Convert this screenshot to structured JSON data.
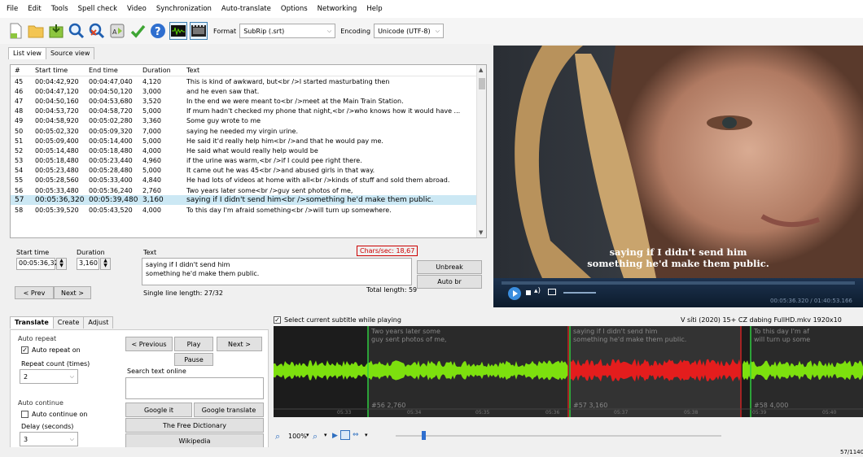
{
  "menu": [
    "File",
    "Edit",
    "Tools",
    "Spell check",
    "Video",
    "Synchronization",
    "Auto-translate",
    "Options",
    "Networking",
    "Help"
  ],
  "toolbar": {
    "format_label": "Format",
    "format_value": "SubRip (.srt)",
    "encoding_label": "Encoding",
    "encoding_value": "Unicode (UTF-8)"
  },
  "tabs": {
    "list_view": "List view",
    "source_view": "Source view"
  },
  "list": {
    "headers": [
      "#",
      "Start time",
      "End time",
      "Duration",
      "Text"
    ],
    "rows": [
      [
        "45",
        "00:04:42,920",
        "00:04:47,040",
        "4,120",
        "This is kind of awkward, but<br />I started masturbating then"
      ],
      [
        "46",
        "00:04:47,120",
        "00:04:50,120",
        "3,000",
        "and he even saw that."
      ],
      [
        "47",
        "00:04:50,160",
        "00:04:53,680",
        "3,520",
        "In the end we were meant to<br />meet at the Main Train Station."
      ],
      [
        "48",
        "00:04:53,720",
        "00:04:58,720",
        "5,000",
        "If mum hadn't checked my phone that night,<br />who knows how it would have ..."
      ],
      [
        "49",
        "00:04:58,920",
        "00:05:02,280",
        "3,360",
        "Some guy wrote to me"
      ],
      [
        "50",
        "00:05:02,320",
        "00:05:09,320",
        "7,000",
        "saying he needed my virgin urine."
      ],
      [
        "51",
        "00:05:09,400",
        "00:05:14,400",
        "5,000",
        "He said it'd really help him<br />and that he would pay me."
      ],
      [
        "52",
        "00:05:14,480",
        "00:05:18,480",
        "4,000",
        "He said what would really help would be"
      ],
      [
        "53",
        "00:05:18,480",
        "00:05:23,440",
        "4,960",
        "if the urine was warm,<br />if I could pee right there."
      ],
      [
        "54",
        "00:05:23,480",
        "00:05:28,480",
        "5,000",
        "It came out he was 45<br />and abused girls in that way."
      ],
      [
        "55",
        "00:05:28,560",
        "00:05:33,400",
        "4,840",
        "He had lots of videos at home with all<br />kinds of stuff and sold them abroad."
      ],
      [
        "56",
        "00:05:33,480",
        "00:05:36,240",
        "2,760",
        "Two years later some<br />guy sent photos of me,"
      ],
      [
        "57",
        "00:05:36,320",
        "00:05:39,480",
        "3,160",
        "saying if I didn't send him<br />something he'd make them public."
      ],
      [
        "58",
        "00:05:39,520",
        "00:05:43,520",
        "4,000",
        "To this day I'm afraid something<br />will turn up somewhere."
      ]
    ],
    "selected_index": 12
  },
  "edit": {
    "start_label": "Start time",
    "start_value": "00:05:36,320",
    "duration_label": "Duration",
    "duration_value": "3,160",
    "text_label": "Text",
    "text_line1": "saying if I didn't send him",
    "text_line2": "something he'd make them public.",
    "chars_sec": "Chars/sec: 18,67",
    "single_line": "Single line length: 27/32",
    "total_length": "Total length: 59",
    "unbreak": "Unbreak",
    "auto_br": "Auto br",
    "prev": "< Prev",
    "next": "Next >"
  },
  "video": {
    "sub_line1": "saying if I didn't send him",
    "sub_line2": "something he'd make them public.",
    "time": "00:05:36.320 / 01:40:53.166"
  },
  "bottom_tabs": [
    "Translate",
    "Create",
    "Adjust"
  ],
  "translate": {
    "auto_repeat_title": "Auto repeat",
    "auto_repeat_on": "Auto repeat on",
    "repeat_count_label": "Repeat count (times)",
    "repeat_count_value": "2",
    "auto_continue_title": "Auto continue",
    "auto_continue_on": "Auto continue on",
    "delay_label": "Delay (seconds)",
    "delay_value": "3",
    "previous": "< Previous",
    "play": "Play",
    "next": "Next >",
    "pause": "Pause",
    "search_label": "Search text online",
    "google_it": "Google it",
    "google_translate": "Google translate",
    "free_dictionary": "The Free Dictionary",
    "wikipedia": "Wikipedia"
  },
  "waveform": {
    "select_label": "Select current subtitle while playing",
    "file_label": "V síti (2020) 15+ CZ dabing FullHD.mkv 1920x10",
    "sub1_text": "Two years later some\nguy sent photos of me,",
    "sub1_info": "#56  2,760",
    "sub2_text": "saying if I didn't send him\nsomething he'd make them public.",
    "sub2_info": "#57  3,160",
    "sub3_text": "To this day I'm af\nwill turn up some",
    "sub3_info": "#58  4,000",
    "ticks": [
      "05:33",
      "05:34",
      "05:35",
      "05:36",
      "05:37",
      "05:38",
      "05:39",
      "05:40"
    ],
    "zoom": "100%"
  },
  "status": {
    "position": "57/1140"
  },
  "colors": {
    "accent": "#cc0000",
    "selection": "#cce8f4",
    "wave_green": "#7de00e",
    "wave_red": "#e41d1d"
  }
}
